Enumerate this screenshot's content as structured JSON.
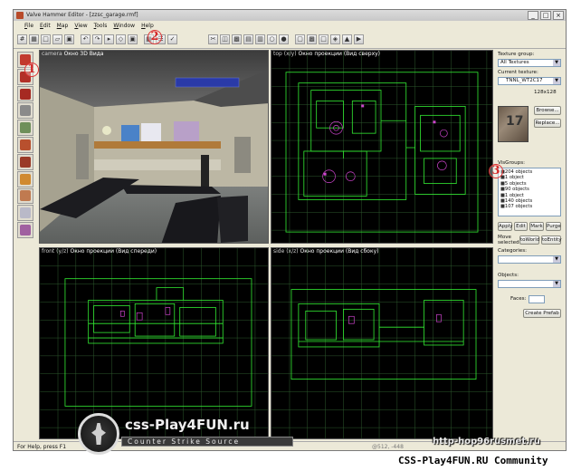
{
  "window": {
    "title": "Valve Hammer Editor - [zzsc_garage.rmf]",
    "buttons": [
      "_",
      "□",
      "×"
    ]
  },
  "menu": [
    "File",
    "Edit",
    "Map",
    "View",
    "Tools",
    "Window",
    "Help"
  ],
  "viewports": {
    "camera": {
      "name": "camera",
      "caption": "Окно 3D Вида"
    },
    "top": {
      "name": "top (x/y)",
      "caption": "Окно проекции (Вид сверху)"
    },
    "front": {
      "name": "front (y/z)",
      "caption": "Окно проекции (Вид спереди)"
    },
    "side": {
      "name": "side (x/z)",
      "caption": "Окно проекции (Вид сбоку)"
    }
  },
  "right_panel": {
    "texture_group_label": "Texture group:",
    "texture_group_value": "All Textures",
    "current_texture_label": "Current texture:",
    "current_texture_value": "TNNL_WT2C17",
    "texture_size": "128x128",
    "texture_preview_digit": "17",
    "browse_label": "Browse...",
    "replace_label": "Replace...",
    "visgroups_label": "VisGroups:",
    "visgroups": [
      "204 objects",
      "1 object",
      "5 objects",
      "90 objects",
      "1 object",
      "140 objects",
      "107 objects"
    ],
    "apply_label": "Apply",
    "edit_label": "Edit",
    "mark_label": "Mark",
    "purge_label": "Purge",
    "move_selected_label": "Move selected:",
    "to_world_label": "toWorld",
    "to_entity_label": "toEntity",
    "categories_label": "Categories:",
    "objects_label": "Objects:",
    "faces_label": "Faces:",
    "create_prefab_label": "Create Prefab"
  },
  "status": {
    "help": "For Help, press F1",
    "coords": "@512, -448"
  },
  "annotations": [
    "1",
    "2",
    "3"
  ],
  "watermark": {
    "title": "css-Play4FUN.ru",
    "subtitle": "Counter Strike Source",
    "url": "http-hop96rusmet.ru",
    "footer": "CSS-Play4FUN.RU Community"
  },
  "colors": {
    "wire": "#33ee33",
    "grid": "#2f5a2f",
    "entity": "#cc44cc",
    "annotation": "#d42a2a"
  }
}
